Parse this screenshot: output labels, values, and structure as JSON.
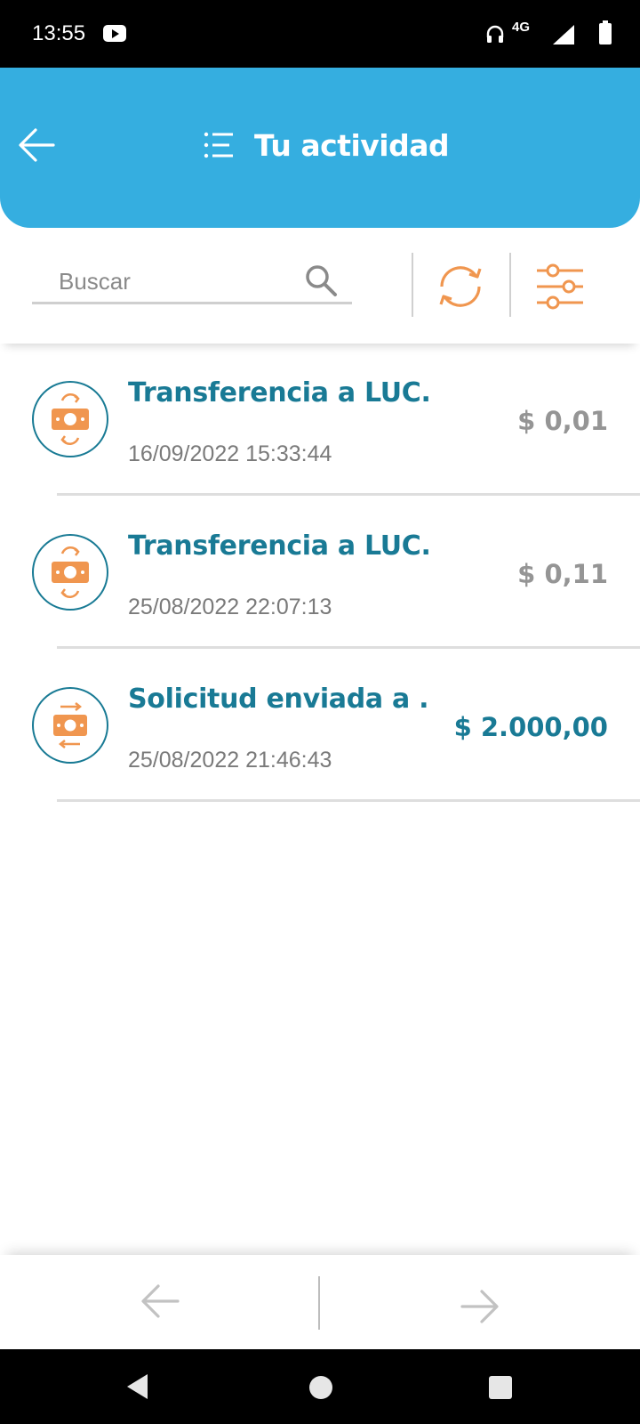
{
  "status_bar": {
    "time": "13:55",
    "network": "4G",
    "icons": [
      "youtube-icon",
      "headset-icon",
      "signal-icon",
      "battery-icon"
    ]
  },
  "header": {
    "title": "Tu actividad",
    "background_color": "#35aee0",
    "icons": [
      "back-arrow-icon",
      "list-icon"
    ]
  },
  "search": {
    "placeholder": "Buscar",
    "value": ""
  },
  "tools": {
    "icons": [
      "refresh-icon",
      "filter-sliders-icon"
    ],
    "accent_color": "#f0964f"
  },
  "activity": [
    {
      "title": "Transferencia a LUC...",
      "date": "16/09/2022 15:33:44",
      "amount": "$ 0,01",
      "icon": "transfer-money-icon",
      "highlight": false
    },
    {
      "title": "Transferencia a LUC...",
      "date": "25/08/2022 22:07:13",
      "amount": "$ 0,11",
      "icon": "transfer-money-icon",
      "highlight": false
    },
    {
      "title": "Solicitud enviada a ...",
      "date": "25/08/2022 21:46:43",
      "amount": "$ 2.000,00",
      "icon": "request-money-icon",
      "highlight": true
    }
  ],
  "pager": {
    "icons": [
      "prev-arrow-icon",
      "next-arrow-icon"
    ]
  },
  "colors": {
    "primary_text": "#197a95",
    "muted_text": "#7a7a7a",
    "icon_orange": "#f0964f"
  }
}
